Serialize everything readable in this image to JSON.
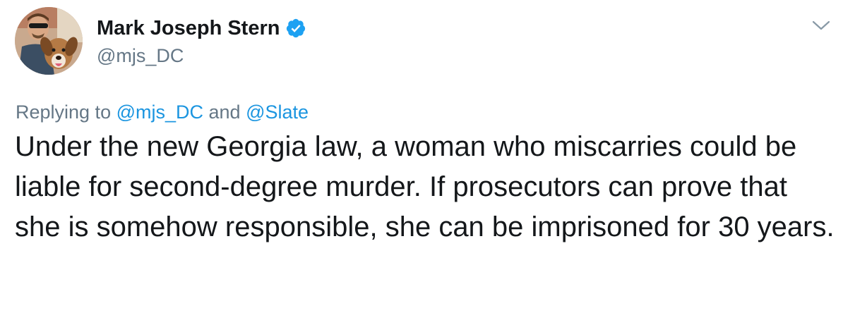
{
  "author": {
    "display_name": "Mark Joseph Stern",
    "handle": "@mjs_DC",
    "verified": true,
    "avatar_icon": "profile-photo-man-with-dog"
  },
  "menu": {
    "icon": "chevron-down-icon"
  },
  "reply": {
    "prefix": "Replying to ",
    "mention_1": "@mjs_DC",
    "joiner": " and ",
    "mention_2": "@Slate"
  },
  "tweet": {
    "text": "Under the new Georgia law, a woman who miscarries could be liable for second-degree murder. If prosecutors can prove that she is somehow responsible, she can be imprisoned for 30 years."
  },
  "colors": {
    "text": "#14171a",
    "secondary": "#657786",
    "link": "#1b95e0",
    "verified": "#1da1f2"
  }
}
